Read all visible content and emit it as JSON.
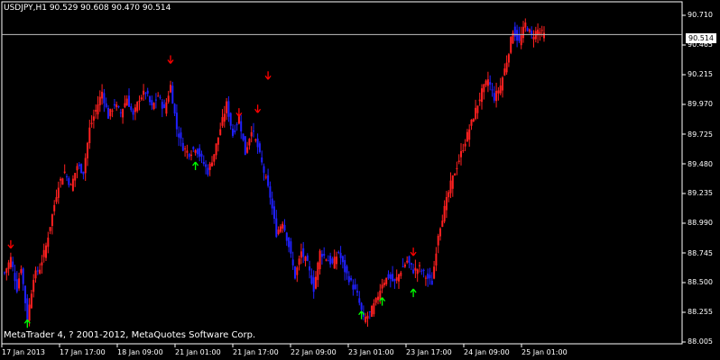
{
  "window": {
    "symbol_info": "USDJPY,H1  90.529 90.608 90.470 90.514",
    "copyright": "MetaTrader 4, ? 2001-2012, MetaQuotes Software Corp."
  },
  "colors": {
    "background": "#000000",
    "frame": "#ffffff",
    "bull_candle": "#ff2020",
    "bear_candle": "#2020ff",
    "up_arrow": "#00ff00",
    "down_arrow": "#ff0000",
    "bid_line": "#c0c0c0"
  },
  "price_axis": {
    "labels": [
      "90.710",
      "90.465",
      "90.215",
      "89.970",
      "89.725",
      "89.480",
      "89.235",
      "88.990",
      "88.745",
      "88.500",
      "88.255",
      "88.005"
    ],
    "current_bid": "90.514"
  },
  "time_axis": {
    "labels": [
      "17 Jan 2013",
      "17 Jan 17:00",
      "18 Jan 09:00",
      "21 Jan 01:00",
      "21 Jan 17:00",
      "22 Jan 09:00",
      "23 Jan 01:00",
      "23 Jan 17:00",
      "24 Jan 09:00",
      "25 Jan 01:00"
    ]
  },
  "chart_data": {
    "type": "candlestick",
    "symbol": "USDJPY",
    "timeframe": "H1",
    "ylim": [
      88.005,
      90.78
    ],
    "close_path": [
      [
        0,
        88.58
      ],
      [
        3,
        88.7
      ],
      [
        6,
        88.45
      ],
      [
        8,
        88.63
      ],
      [
        11,
        88.2
      ],
      [
        14,
        88.55
      ],
      [
        17,
        88.62
      ],
      [
        20,
        88.8
      ],
      [
        23,
        89.05
      ],
      [
        26,
        89.3
      ],
      [
        29,
        89.4
      ],
      [
        32,
        89.28
      ],
      [
        35,
        89.45
      ],
      [
        38,
        89.4
      ],
      [
        41,
        89.75
      ],
      [
        44,
        89.9
      ],
      [
        47,
        90.05
      ],
      [
        50,
        89.85
      ],
      [
        53,
        89.95
      ],
      [
        56,
        89.88
      ],
      [
        59,
        90.0
      ],
      [
        62,
        89.85
      ],
      [
        65,
        90.0
      ],
      [
        68,
        90.05
      ],
      [
        71,
        89.92
      ],
      [
        74,
        90.02
      ],
      [
        77,
        89.9
      ],
      [
        80,
        90.1
      ],
      [
        83,
        89.75
      ],
      [
        86,
        89.6
      ],
      [
        89,
        89.55
      ],
      [
        92,
        89.6
      ],
      [
        95,
        89.5
      ],
      [
        98,
        89.4
      ],
      [
        101,
        89.55
      ],
      [
        104,
        89.75
      ],
      [
        107,
        89.95
      ],
      [
        110,
        89.7
      ],
      [
        113,
        89.85
      ],
      [
        116,
        89.55
      ],
      [
        119,
        89.75
      ],
      [
        122,
        89.6
      ],
      [
        125,
        89.4
      ],
      [
        128,
        89.2
      ],
      [
        131,
        88.9
      ],
      [
        134,
        89.0
      ],
      [
        137,
        88.8
      ],
      [
        140,
        88.55
      ],
      [
        143,
        88.75
      ],
      [
        146,
        88.65
      ],
      [
        149,
        88.45
      ],
      [
        152,
        88.75
      ],
      [
        155,
        88.7
      ],
      [
        158,
        88.65
      ],
      [
        161,
        88.75
      ],
      [
        164,
        88.6
      ],
      [
        167,
        88.5
      ],
      [
        170,
        88.4
      ],
      [
        173,
        88.2
      ],
      [
        176,
        88.25
      ],
      [
        179,
        88.35
      ],
      [
        182,
        88.5
      ],
      [
        185,
        88.55
      ],
      [
        188,
        88.5
      ],
      [
        191,
        88.6
      ],
      [
        194,
        88.68
      ],
      [
        197,
        88.6
      ],
      [
        200,
        88.62
      ],
      [
        203,
        88.55
      ],
      [
        206,
        88.5
      ],
      [
        209,
        88.9
      ],
      [
        212,
        89.1
      ],
      [
        215,
        89.3
      ],
      [
        218,
        89.45
      ],
      [
        221,
        89.6
      ],
      [
        224,
        89.75
      ],
      [
        227,
        89.9
      ],
      [
        230,
        90.05
      ],
      [
        233,
        90.15
      ],
      [
        236,
        90.0
      ],
      [
        239,
        90.1
      ],
      [
        242,
        90.3
      ],
      [
        245,
        90.55
      ],
      [
        248,
        90.45
      ],
      [
        251,
        90.6
      ],
      [
        254,
        90.5
      ],
      [
        257,
        90.55
      ],
      [
        260,
        90.51
      ]
    ],
    "up_signals": [
      {
        "bar": 11,
        "price": 88.2
      },
      {
        "bar": 92,
        "price": 89.48
      },
      {
        "bar": 172,
        "price": 88.27
      },
      {
        "bar": 182,
        "price": 88.38
      },
      {
        "bar": 197,
        "price": 88.45
      }
    ],
    "down_signals": [
      {
        "bar": 3,
        "price": 88.78
      },
      {
        "bar": 80,
        "price": 90.28
      },
      {
        "bar": 113,
        "price": 89.85
      },
      {
        "bar": 122,
        "price": 89.88
      },
      {
        "bar": 127,
        "price": 90.15
      },
      {
        "bar": 197,
        "price": 88.72
      }
    ]
  }
}
